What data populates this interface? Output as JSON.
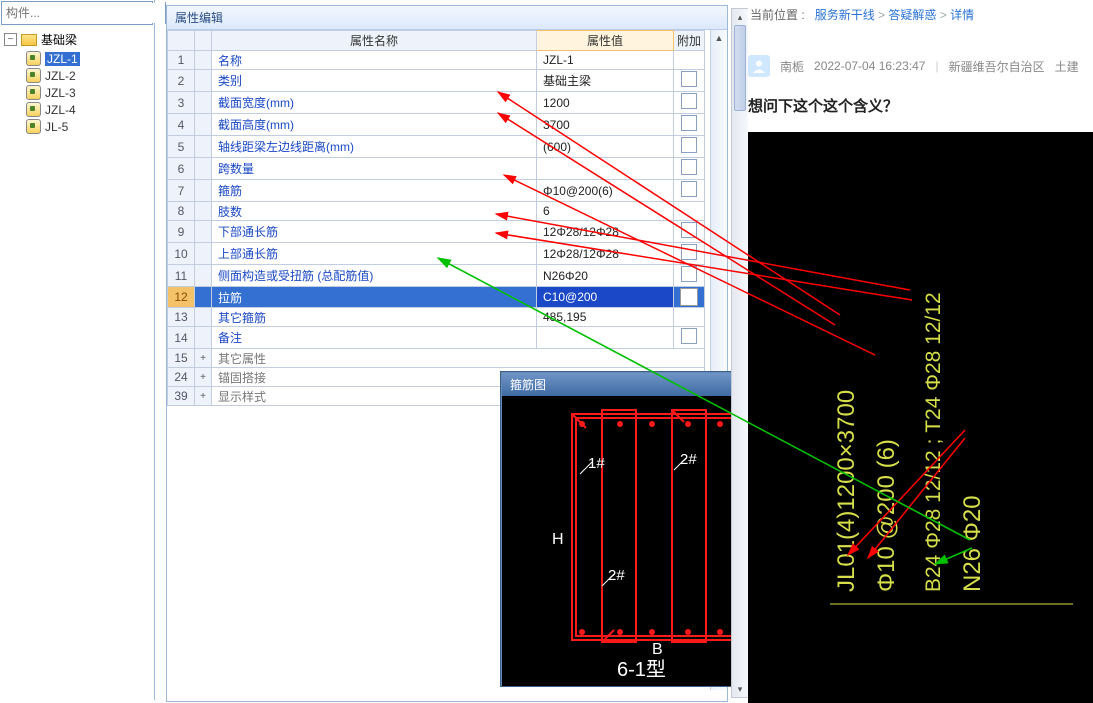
{
  "search": {
    "placeholder": "构件..."
  },
  "tree": {
    "root": "基础梁",
    "items": [
      "JZL-1",
      "JZL-2",
      "JZL-3",
      "JZL-4",
      "JL-5"
    ],
    "selected_index": 0
  },
  "prop_panel": {
    "title": "属性编辑",
    "col_name": "属性名称",
    "col_value": "属性值",
    "col_add": "附加"
  },
  "rows": [
    {
      "n": "1",
      "name": "名称",
      "val": "JZL-1",
      "chk": false
    },
    {
      "n": "2",
      "name": "类别",
      "val": "基础主梁",
      "chk": true
    },
    {
      "n": "3",
      "name": "截面宽度(mm)",
      "val": "1200",
      "chk": true
    },
    {
      "n": "4",
      "name": "截面高度(mm)",
      "val": "3700",
      "chk": true
    },
    {
      "n": "5",
      "name": "轴线距梁左边线距离(mm)",
      "val": "(600)",
      "chk": true
    },
    {
      "n": "6",
      "name": "跨数量",
      "val": "",
      "chk": true
    },
    {
      "n": "7",
      "name": "箍筋",
      "val": "Φ10@200(6)",
      "chk": true
    },
    {
      "n": "8",
      "name": "肢数",
      "val": "6",
      "chk": false
    },
    {
      "n": "9",
      "name": "下部通长筋",
      "val": "12Φ28/12Φ28",
      "chk": true
    },
    {
      "n": "10",
      "name": "上部通长筋",
      "val": "12Φ28/12Φ28",
      "chk": true
    },
    {
      "n": "11",
      "name": "侧面构造或受扭筋 (总配筋值)",
      "val": "N26Φ20",
      "chk": true
    },
    {
      "n": "12",
      "name": "拉筋",
      "val": "C10@200",
      "chk": false,
      "selected": true
    },
    {
      "n": "13",
      "name": "其它箍筋",
      "val": "485,195",
      "chk": false
    },
    {
      "n": "14",
      "name": "备注",
      "val": "",
      "chk": true
    }
  ],
  "group_rows": [
    {
      "n": "15",
      "name": "其它属性"
    },
    {
      "n": "24",
      "name": "锚固搭接"
    },
    {
      "n": "39",
      "name": "显示样式"
    }
  ],
  "brace": {
    "title": "箍筋图",
    "mark1": "1#",
    "mark2a": "2#",
    "mark2b": "2#",
    "H": "H",
    "B": "B",
    "type_label": "6-1型"
  },
  "forum": {
    "breadcrumb_prefix": "当前位置  :",
    "crumb1": "服务新干线",
    "crumb2": "答疑解惑",
    "crumb3": "详情",
    "sep": ">",
    "user": "南栀",
    "time": "2022-07-04 16:23:47",
    "divider": "|",
    "region": "新疆维吾尔自治区",
    "region2": "土建",
    "question": "想问下这个这个含义？"
  },
  "cad_lines": [
    "JL01(4)1200×3700",
    "Φ10 @200 (6)",
    "B24 Φ28 12/12 ; T24 Φ28 12/12",
    "N26 Φ20"
  ]
}
